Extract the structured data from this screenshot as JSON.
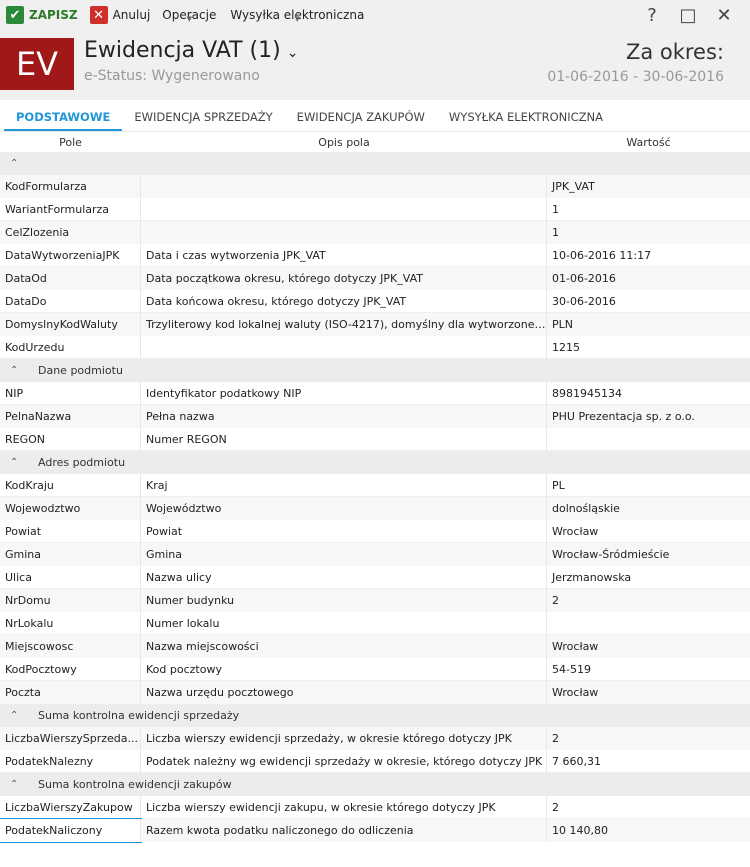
{
  "toolbar": {
    "save_label": "ZAPISZ",
    "cancel_label": "Anuluj",
    "operations_label": "Operacje",
    "send_label": "Wysyłka elektroniczna",
    "help_icon": "question-icon",
    "window_controls": [
      "?",
      "□",
      "✕"
    ]
  },
  "header": {
    "logo_text": "EV",
    "title": "Ewidencja VAT (1)",
    "status": "e-Status: Wygenerowano",
    "period_label": "Za okres:",
    "period_value": "01-06-2016 - 30-06-2016"
  },
  "tabs": [
    {
      "label": "PODSTAWOWE",
      "active": true
    },
    {
      "label": "EWIDENCJA SPRZEDAŻY",
      "active": false
    },
    {
      "label": "EWIDENCJA ZAKUPÓW",
      "active": false
    },
    {
      "label": "WYSYŁKA ELEKTRONICZNA",
      "active": false
    }
  ],
  "columns": {
    "field": "Pole",
    "description": "Opis pola",
    "value": "Wartość"
  },
  "sections": [
    {
      "title": "",
      "rows": [
        {
          "field": "KodFormularza",
          "description": "",
          "value": "JPK_VAT"
        },
        {
          "field": "WariantFormularza",
          "description": "",
          "value": "1"
        },
        {
          "field": "CelZlozenia",
          "description": "",
          "value": "1"
        },
        {
          "field": "DataWytworzeniaJPK",
          "description": "Data i czas wytworzenia JPK_VAT",
          "value": "10-06-2016 11:17"
        },
        {
          "field": "DataOd",
          "description": "Data początkowa okresu, którego dotyczy JPK_VAT",
          "value": "01-06-2016"
        },
        {
          "field": "DataDo",
          "description": "Data końcowa okresu, którego dotyczy JPK_VAT",
          "value": "30-06-2016"
        },
        {
          "field": "DomyslnyKodWaluty",
          "description": "Trzyliterowy kod lokalnej waluty (ISO-4217), domyślny dla wytworzonego...",
          "value": "PLN"
        },
        {
          "field": "KodUrzedu",
          "description": "",
          "value": "1215"
        }
      ]
    },
    {
      "title": "Dane podmiotu",
      "rows": [
        {
          "field": "NIP",
          "description": "Identyfikator podatkowy NIP",
          "value": "8981945134"
        },
        {
          "field": "PelnaNazwa",
          "description": "Pełna nazwa",
          "value": "PHU Prezentacja sp. z o.o."
        },
        {
          "field": "REGON",
          "description": "Numer REGON",
          "value": ""
        }
      ]
    },
    {
      "title": "Adres podmiotu",
      "rows": [
        {
          "field": "KodKraju",
          "description": "Kraj",
          "value": "PL"
        },
        {
          "field": "Wojewodztwo",
          "description": "Województwo",
          "value": "dolnośląskie"
        },
        {
          "field": "Powiat",
          "description": "Powiat",
          "value": "Wrocław"
        },
        {
          "field": "Gmina",
          "description": "Gmina",
          "value": "Wrocław-Śródmieście"
        },
        {
          "field": "Ulica",
          "description": "Nazwa ulicy",
          "value": "Jerzmanowska"
        },
        {
          "field": "NrDomu",
          "description": "Numer budynku",
          "value": "2"
        },
        {
          "field": "NrLokalu",
          "description": "Numer lokalu",
          "value": ""
        },
        {
          "field": "Miejscowosc",
          "description": "Nazwa miejscowości",
          "value": "Wrocław"
        },
        {
          "field": "KodPocztowy",
          "description": "Kod pocztowy",
          "value": "54-519"
        },
        {
          "field": "Poczta",
          "description": "Nazwa urzędu pocztowego",
          "value": "Wrocław"
        }
      ]
    },
    {
      "title": "Suma kontrolna ewidencji sprzedaży",
      "rows": [
        {
          "field": "LiczbaWierszySprzeda...",
          "description": "Liczba wierszy ewidencji sprzedaży, w okresie którego dotyczy JPK",
          "value": "2"
        },
        {
          "field": "PodatekNalezny",
          "description": "Podatek należny wg ewidencji sprzedaży w okresie, którego dotyczy JPK",
          "value": "7 660,31"
        }
      ]
    },
    {
      "title": "Suma kontrolna ewidencji zakupów",
      "rows": [
        {
          "field": "LiczbaWierszyZakupow",
          "description": "Liczba wierszy ewidencji zakupu, w okresie którego dotyczy JPK",
          "value": "2"
        },
        {
          "field": "PodatekNaliczony",
          "description": "Razem kwota podatku naliczonego do odliczenia",
          "value": "10 140,80",
          "focused": true
        }
      ]
    }
  ]
}
